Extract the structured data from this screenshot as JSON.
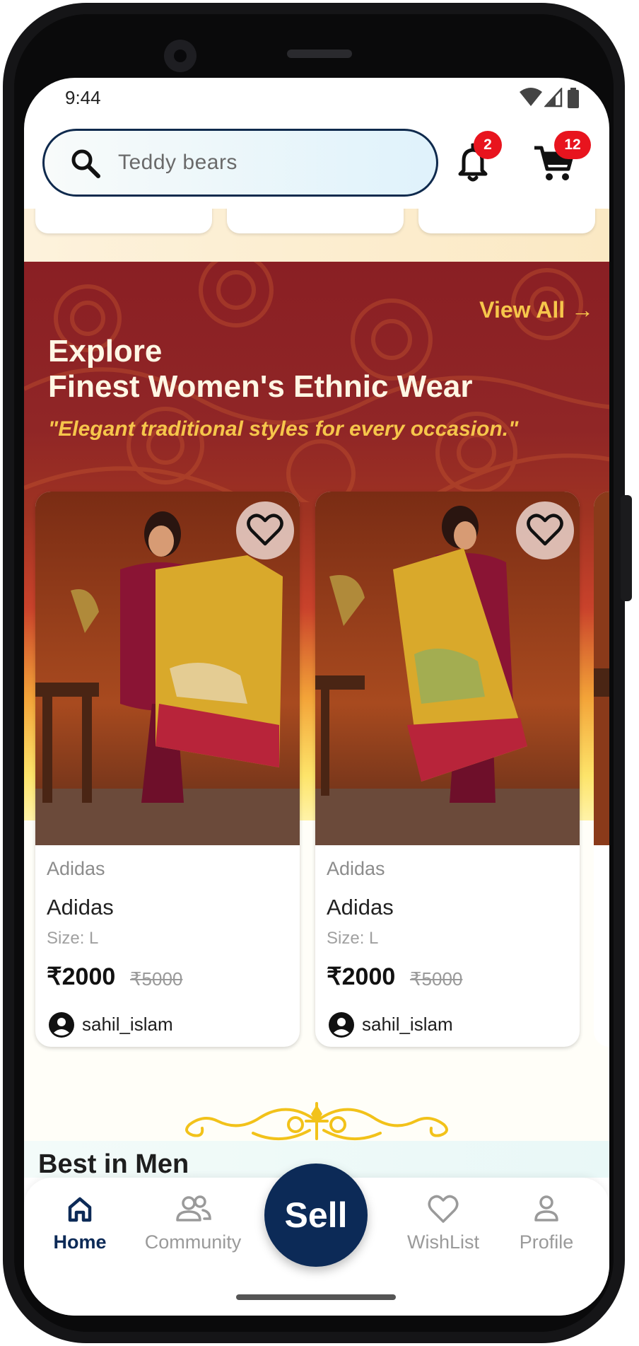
{
  "status_bar": {
    "time": "9:44"
  },
  "search": {
    "placeholder": "Teddy bears"
  },
  "header": {
    "notifications_count": "2",
    "cart_count": "12"
  },
  "banner": {
    "view_all": "View All →",
    "title_line1": "Explore",
    "title_line2": "Finest Women's Ethnic Wear",
    "subtitle": "\"Elegant traditional styles for every occasion.\""
  },
  "products": [
    {
      "brand": "Adidas",
      "name": "Adidas",
      "size": "Size: L",
      "price": "₹2000",
      "mrp": "₹5000",
      "seller": "sahil_islam"
    },
    {
      "brand": "Adidas",
      "name": "Adidas",
      "size": "Size: L",
      "price": "₹2000",
      "mrp": "₹5000",
      "seller": "sahil_islam"
    }
  ],
  "next_section": {
    "title": "Best in Men"
  },
  "nav": {
    "home": "Home",
    "community": "Community",
    "sell": "Sell",
    "wishlist": "WishList",
    "profile": "Profile"
  },
  "colors": {
    "primary": "#0c2a57",
    "badge": "#e8141e",
    "banner_accent": "#f6c64b",
    "banner_dark": "#8a1f24"
  }
}
